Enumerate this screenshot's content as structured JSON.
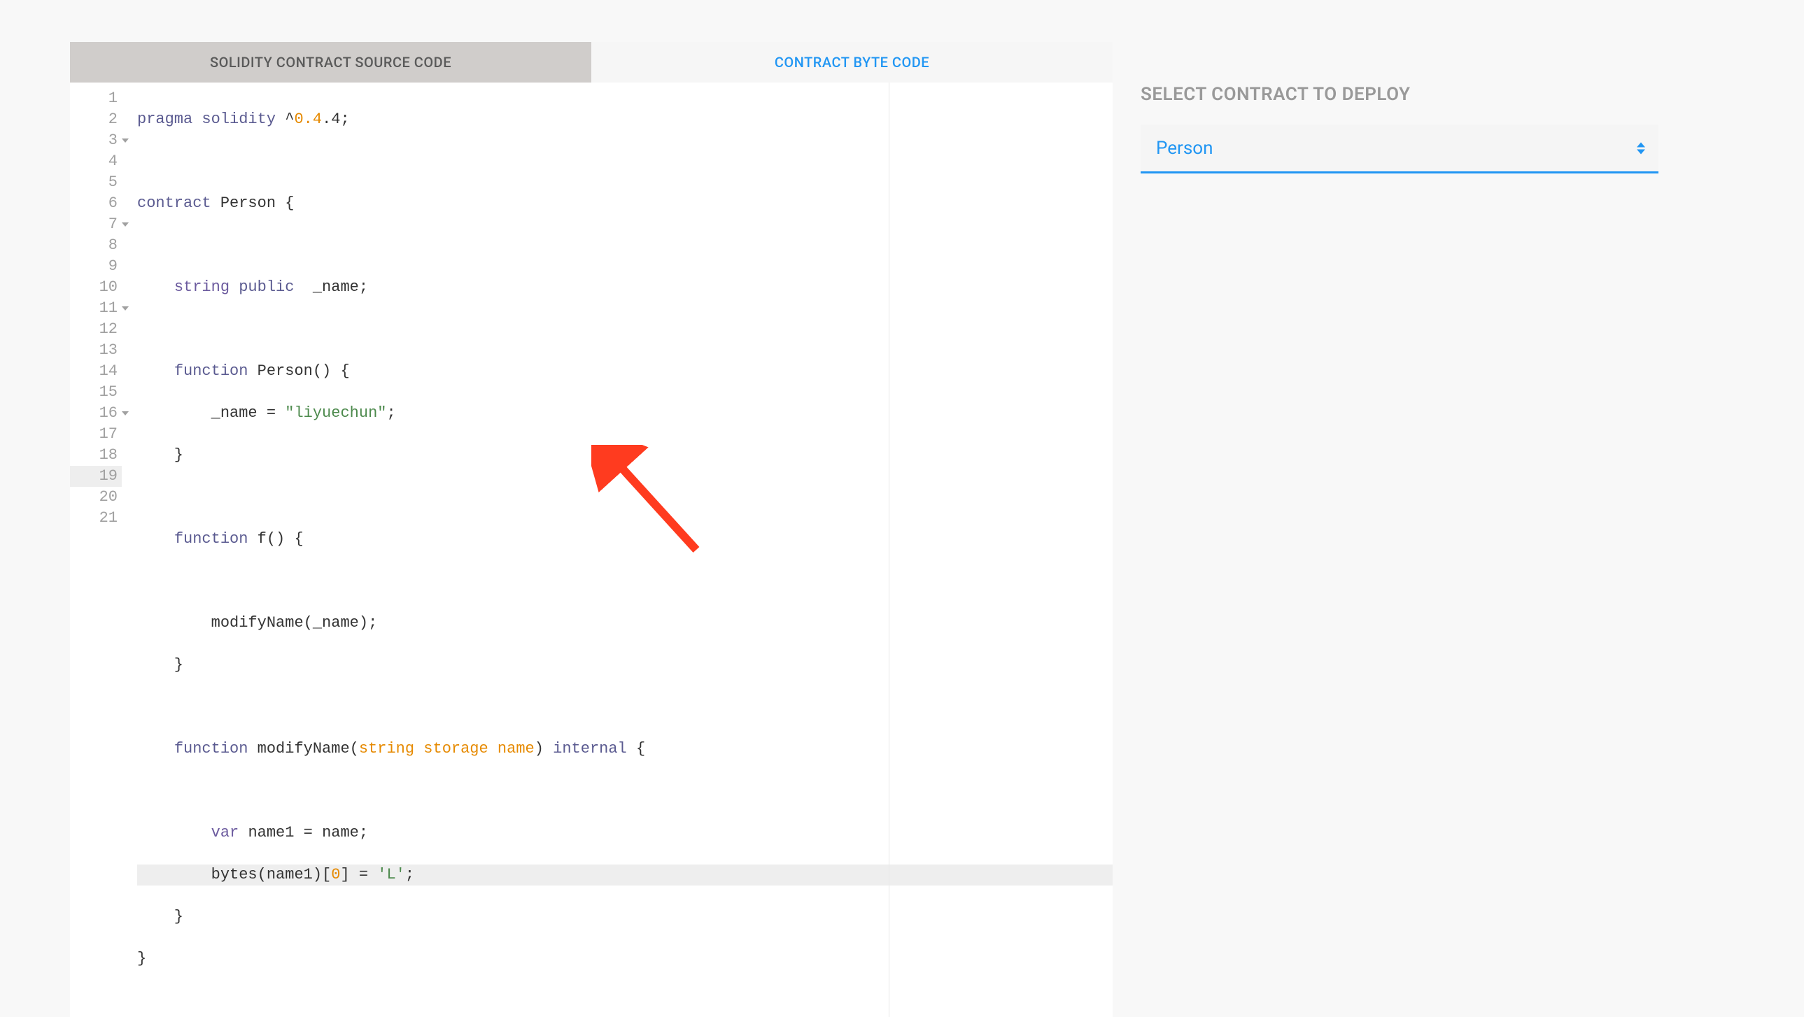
{
  "tabs": {
    "source": "SOLIDITY CONTRACT SOURCE CODE",
    "bytecode": "CONTRACT BYTE CODE"
  },
  "deploy": {
    "title": "SELECT CONTRACT TO DEPLOY",
    "selected": "Person"
  },
  "code": {
    "lines": [
      {
        "n": "1",
        "fold": false,
        "hl": false
      },
      {
        "n": "2",
        "fold": false,
        "hl": false
      },
      {
        "n": "3",
        "fold": true,
        "hl": false
      },
      {
        "n": "4",
        "fold": false,
        "hl": false
      },
      {
        "n": "5",
        "fold": false,
        "hl": false
      },
      {
        "n": "6",
        "fold": false,
        "hl": false
      },
      {
        "n": "7",
        "fold": true,
        "hl": false
      },
      {
        "n": "8",
        "fold": false,
        "hl": false
      },
      {
        "n": "9",
        "fold": false,
        "hl": false
      },
      {
        "n": "10",
        "fold": false,
        "hl": false
      },
      {
        "n": "11",
        "fold": true,
        "hl": false
      },
      {
        "n": "12",
        "fold": false,
        "hl": false
      },
      {
        "n": "13",
        "fold": false,
        "hl": false
      },
      {
        "n": "14",
        "fold": false,
        "hl": false
      },
      {
        "n": "15",
        "fold": false,
        "hl": false
      },
      {
        "n": "16",
        "fold": true,
        "hl": false
      },
      {
        "n": "17",
        "fold": false,
        "hl": false
      },
      {
        "n": "18",
        "fold": false,
        "hl": false
      },
      {
        "n": "19",
        "fold": false,
        "hl": true
      },
      {
        "n": "20",
        "fold": false,
        "hl": false
      },
      {
        "n": "21",
        "fold": false,
        "hl": false
      }
    ],
    "tokens": {
      "l1_pragma": "pragma",
      "l1_solidity": "solidity",
      "l1_ver": "0.4",
      "l1_ver2": ".4",
      "l3_contract": "contract",
      "l3_name": "Person",
      "l5_string": "string",
      "l5_public": "public",
      "l5_name": "_name",
      "l7_function": "function",
      "l7_name": "Person",
      "l8_name": "_name",
      "l8_str": "\"liyuechun\"",
      "l11_function": "function",
      "l11_name": "f",
      "l13_call": "modifyName",
      "l13_arg": "_name",
      "l16_function": "function",
      "l16_name": "modifyName",
      "l16_string": "string",
      "l16_storage": "storage",
      "l16_pname": "name",
      "l16_internal": "internal",
      "l18_var": "var",
      "l18_name1": "name1",
      "l18_name": "name",
      "l19_bytes": "bytes",
      "l19_arg": "name1",
      "l19_idx": "0",
      "l19_char": "'L'"
    }
  }
}
